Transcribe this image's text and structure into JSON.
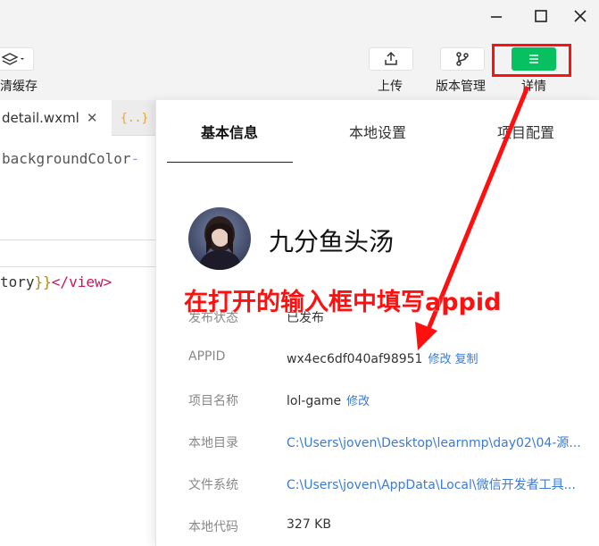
{
  "toolbar": {
    "cache_label": "清缓存",
    "upload_label": "上传",
    "version_label": "版本管理",
    "details_label": "详情"
  },
  "editor": {
    "active_tab": "detail.wxml",
    "second_tab_prefix": "a",
    "line1": "backgroundColor",
    "line2_var": "tory",
    "line2_brace": "}}",
    "line2_tag": "</view>"
  },
  "panel": {
    "tabs": [
      "基本信息",
      "本地设置",
      "项目配置"
    ],
    "project_name": "九分鱼头汤",
    "rows": [
      {
        "label": "发布状态",
        "value": "已发布"
      },
      {
        "label": "APPID",
        "value": "wx4ec6df040af98951",
        "links": [
          "修改",
          "复制"
        ]
      },
      {
        "label": "项目名称",
        "value": "lol-game",
        "links": [
          "修改"
        ]
      },
      {
        "label": "本地目录",
        "value": "C:\\Users\\joven\\Desktop\\learnmp\\day02\\04-源..."
      },
      {
        "label": "文件系统",
        "value": "C:\\Users\\joven\\AppData\\Local\\微信开发者工具..."
      },
      {
        "label": "本地代码",
        "value": "327 KB"
      }
    ]
  },
  "annotation": {
    "text": "在打开的输入框中填写appid",
    "color": "#ff1010"
  },
  "colors": {
    "accent_green": "#07c160",
    "link_blue": "#3a7bd5"
  }
}
